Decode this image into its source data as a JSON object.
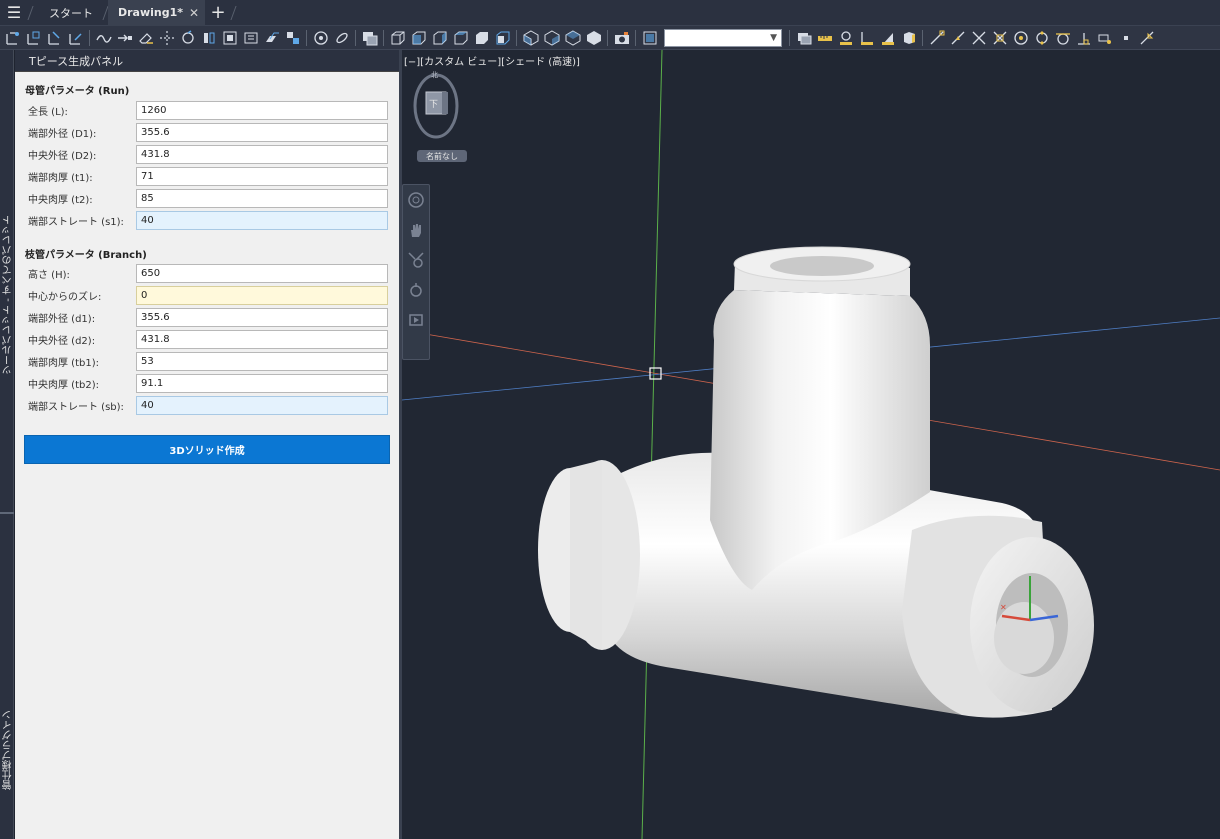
{
  "tabs": {
    "start_label": "スタート",
    "drawing_label": "Drawing1*",
    "close_glyph": "✕",
    "add_glyph": "+"
  },
  "toolbar": {
    "view_combo_value": ""
  },
  "side_strip": {
    "palette_label": "ツールパレット - すべてのパレット",
    "plugin_label": "管仕様プラグイン"
  },
  "panel": {
    "title": "Tピース生成パネル",
    "run_section": {
      "title": "母管パラメータ (Run)",
      "fields": [
        {
          "label": "全長 (L):",
          "value": "1260",
          "style": "normal"
        },
        {
          "label": "端部外径 (D1):",
          "value": "355.6",
          "style": "normal"
        },
        {
          "label": "中央外径 (D2):",
          "value": "431.8",
          "style": "normal"
        },
        {
          "label": "端部肉厚 (t1):",
          "value": "71",
          "style": "normal"
        },
        {
          "label": "中央肉厚 (t2):",
          "value": "85",
          "style": "normal"
        },
        {
          "label": "端部ストレート (s1):",
          "value": "40",
          "style": "blue"
        }
      ]
    },
    "branch_section": {
      "title": "枝管パラメータ (Branch)",
      "fields": [
        {
          "label": "高さ (H):",
          "value": "650",
          "style": "normal"
        },
        {
          "label": "中心からのズレ:",
          "value": "0",
          "style": "yellow"
        },
        {
          "label": "端部外径 (d1):",
          "value": "355.6",
          "style": "normal"
        },
        {
          "label": "中央外径 (d2):",
          "value": "431.8",
          "style": "normal"
        },
        {
          "label": "端部肉厚 (tb1):",
          "value": "53",
          "style": "normal"
        },
        {
          "label": "中央肉厚 (tb2):",
          "value": "91.1",
          "style": "normal"
        },
        {
          "label": "端部ストレート (sb):",
          "value": "40",
          "style": "blue"
        }
      ]
    },
    "create_button_label": "3Dソリッド作成"
  },
  "viewport": {
    "view_label": "[−][カスタム ビュー][シェード (高速)]",
    "viewcube_face": "下",
    "viewcube_compass": "北",
    "named_view_badge": "名前なし"
  },
  "colors": {
    "accent": "#0b77d3",
    "viewport_bg": "#212733",
    "axis_x": "#e0604a",
    "axis_y": "#4a9a3a",
    "axis_z": "#4a7ac8"
  }
}
